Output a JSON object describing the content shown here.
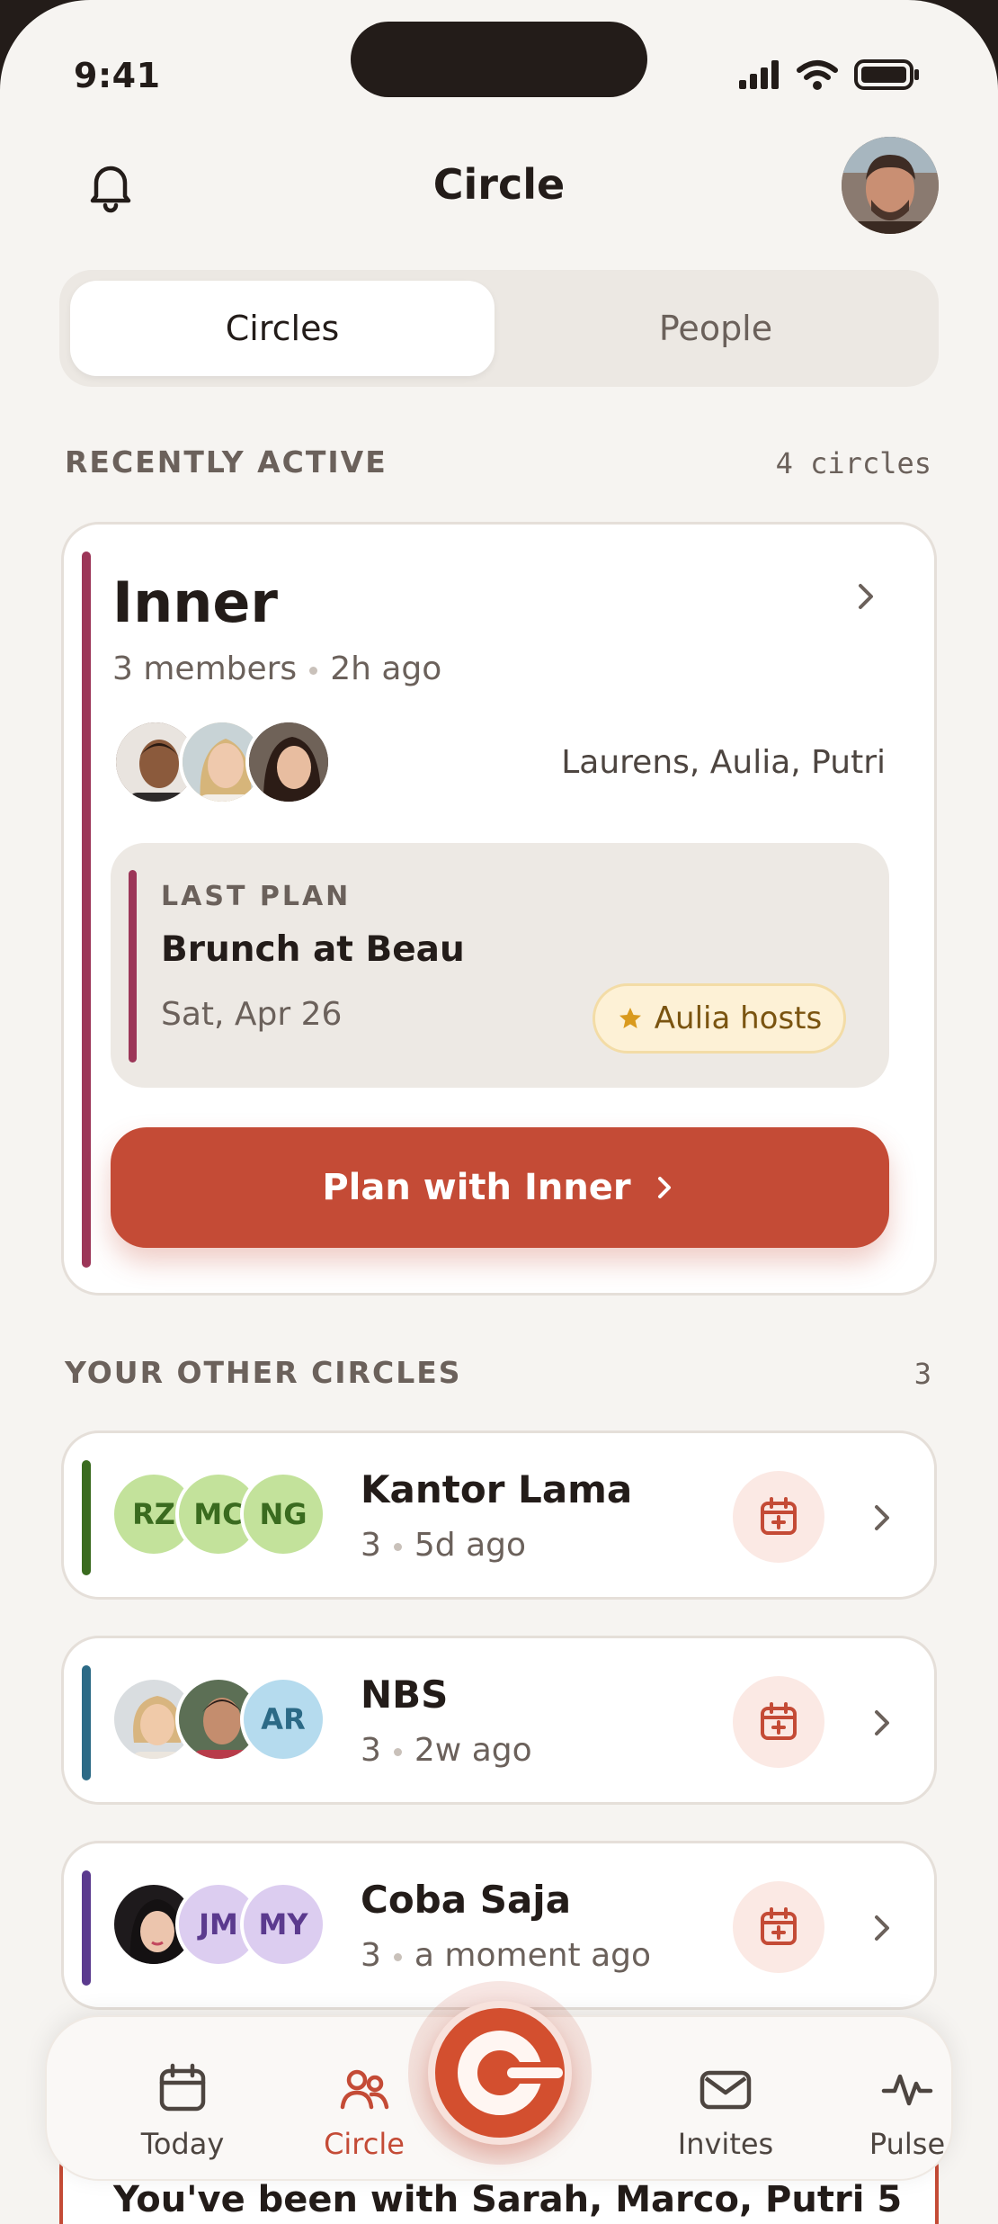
{
  "status": {
    "time": "9:41"
  },
  "header": {
    "title": "Circle"
  },
  "segmented": {
    "tabs": [
      {
        "label": "Circles",
        "active": true
      },
      {
        "label": "People",
        "active": false
      }
    ]
  },
  "recent": {
    "label": "RECENTLY ACTIVE",
    "count": "4 circles",
    "card": {
      "name": "Inner",
      "members": "3 members",
      "time": "2h ago",
      "member_names": "Laurens, Aulia, Putri",
      "accent_color": "#9c3658",
      "last_plan": {
        "label": "LAST PLAN",
        "title": "Brunch at Beau",
        "date": "Sat, Apr 26",
        "host": "Aulia hosts"
      },
      "cta": "Plan with Inner"
    }
  },
  "other": {
    "label": "YOUR OTHER CIRCLES",
    "count": "3",
    "items": [
      {
        "name": "Kantor Lama",
        "count": "3",
        "time": "5d ago",
        "accent_color": "#3a6b1f",
        "initials": [
          "RZ",
          "MC",
          "NG"
        ]
      },
      {
        "name": "NBS",
        "count": "3",
        "time": "2w ago",
        "accent_color": "#2c6a86",
        "initials": [
          "AR"
        ]
      },
      {
        "name": "Coba Saja",
        "count": "3",
        "time": "a moment ago",
        "accent_color": "#5b3a8e",
        "initials": [
          "JM",
          "MY"
        ]
      }
    ]
  },
  "banner": {
    "text": "You've been with Sarah, Marco, Putri 5"
  },
  "tabbar": {
    "items": [
      {
        "label": "Today"
      },
      {
        "label": "Circle"
      },
      {
        "label": "Invites"
      },
      {
        "label": "Pulse"
      }
    ]
  },
  "colors": {
    "accent": "#c44b36",
    "background": "#f6f4f1"
  }
}
